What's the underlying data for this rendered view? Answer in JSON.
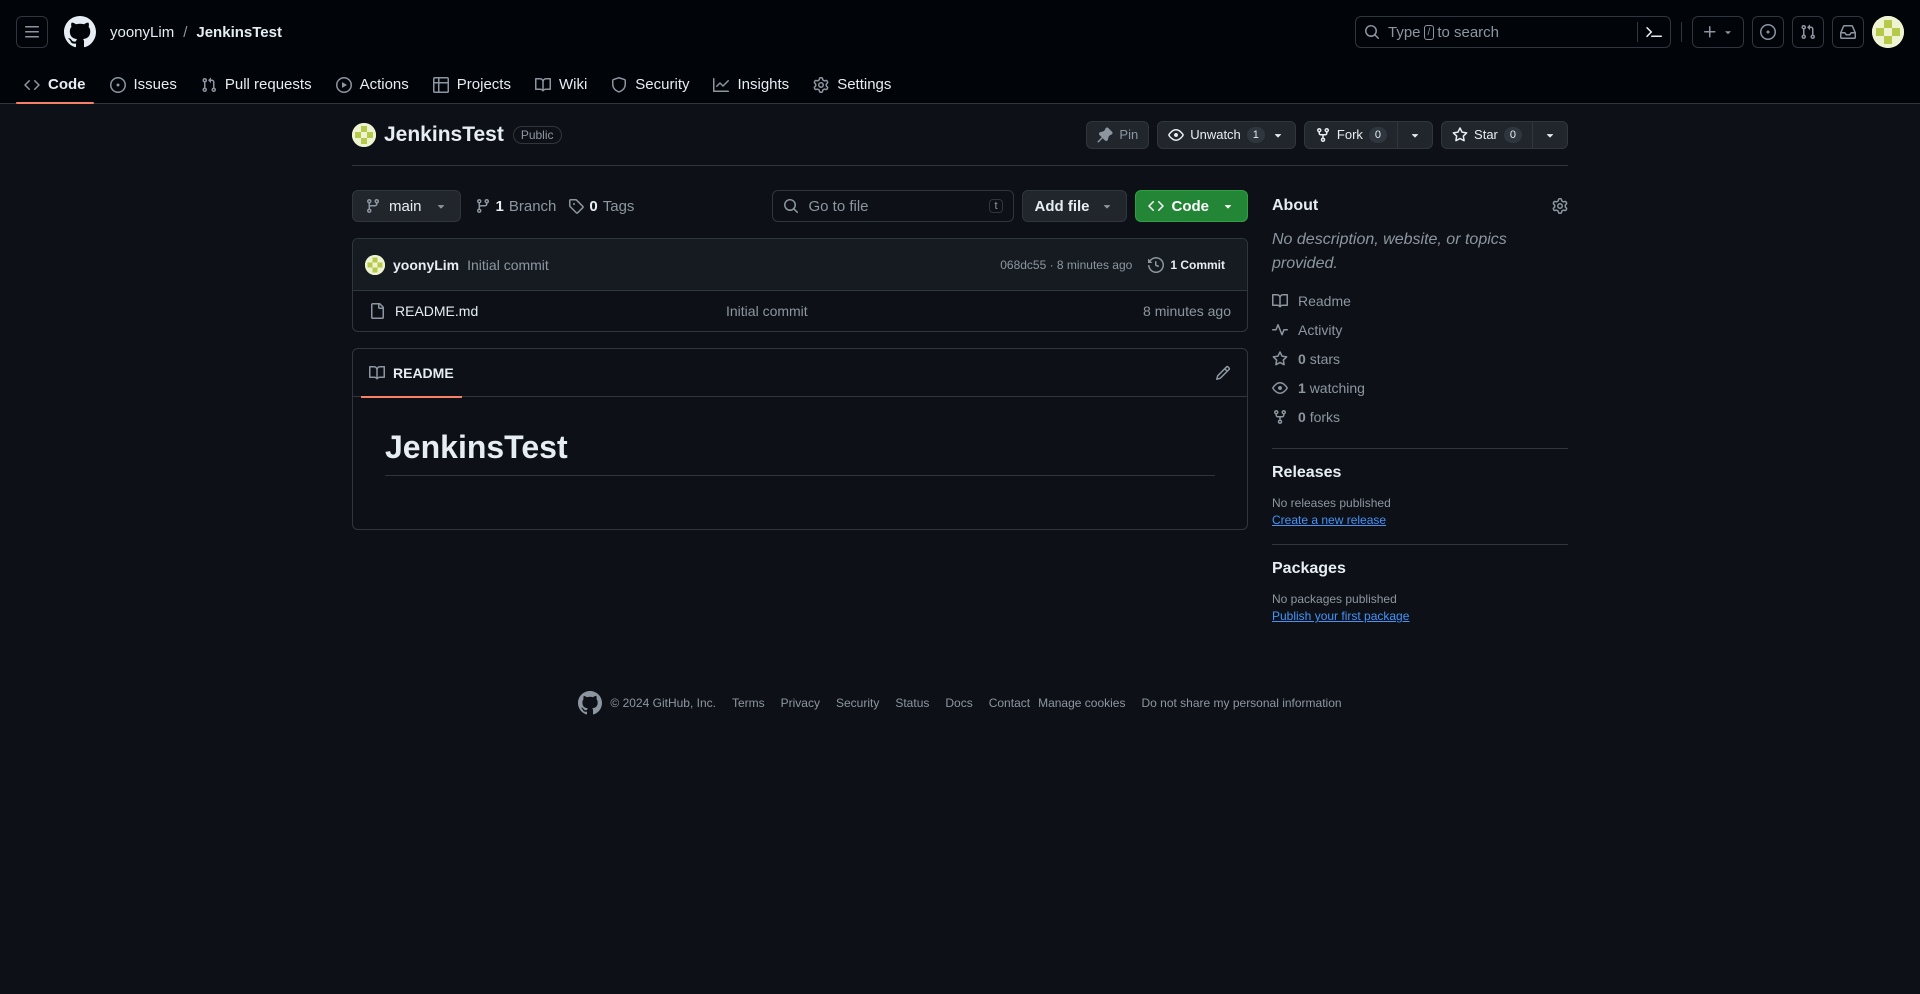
{
  "header": {
    "owner": "yoonyLim",
    "separator": "/",
    "repo": "JenkinsTest",
    "search_prefix": "Type",
    "search_key": "/",
    "search_suffix": "to search"
  },
  "tabs": [
    {
      "label": "Code",
      "icon": "code-icon",
      "active": true
    },
    {
      "label": "Issues",
      "icon": "issue-icon"
    },
    {
      "label": "Pull requests",
      "icon": "pull-request-icon"
    },
    {
      "label": "Actions",
      "icon": "play-icon"
    },
    {
      "label": "Projects",
      "icon": "table-icon"
    },
    {
      "label": "Wiki",
      "icon": "book-icon"
    },
    {
      "label": "Security",
      "icon": "shield-icon"
    },
    {
      "label": "Insights",
      "icon": "graph-icon"
    },
    {
      "label": "Settings",
      "icon": "gear-icon"
    }
  ],
  "repo": {
    "title": "JenkinsTest",
    "visibility": "Public",
    "pin_label": "Pin",
    "unwatch_label": "Unwatch",
    "watch_count": "1",
    "fork_label": "Fork",
    "fork_count": "0",
    "star_label": "Star",
    "star_count": "0"
  },
  "filebar": {
    "branch": "main",
    "branch_count": "1",
    "branch_label": "Branch",
    "tag_count": "0",
    "tag_label": "Tags",
    "goto_placeholder": "Go to file",
    "goto_key": "t",
    "add_file": "Add file",
    "code_label": "Code"
  },
  "commit": {
    "user": "yoonyLim",
    "message": "Initial commit",
    "sha_time": "068dc55 · 8 minutes ago",
    "commits_label": "1 Commit"
  },
  "files": [
    {
      "name": "README.md",
      "message": "Initial commit",
      "time": "8 minutes ago"
    }
  ],
  "readme": {
    "tab_label": "README",
    "heading": "JenkinsTest"
  },
  "about": {
    "title": "About",
    "description": "No description, website, or topics provided.",
    "readme": "Readme",
    "activity": "Activity",
    "stars_count": "0",
    "stars_label": "stars",
    "watching_count": "1",
    "watching_label": "watching",
    "forks_count": "0",
    "forks_label": "forks"
  },
  "releases": {
    "title": "Releases",
    "note": "No releases published",
    "link": "Create a new release"
  },
  "packages": {
    "title": "Packages",
    "note": "No packages published",
    "link": "Publish your first package"
  },
  "footer": {
    "copyright": "© 2024 GitHub, Inc.",
    "links": [
      "Terms",
      "Privacy",
      "Security",
      "Status",
      "Docs",
      "Contact",
      "Manage cookies",
      "Do not share my personal information"
    ]
  },
  "colors": {
    "accent_tab": "#f78166",
    "code_button": "#238636",
    "link": "#4493f8",
    "background": "#0d1117"
  }
}
